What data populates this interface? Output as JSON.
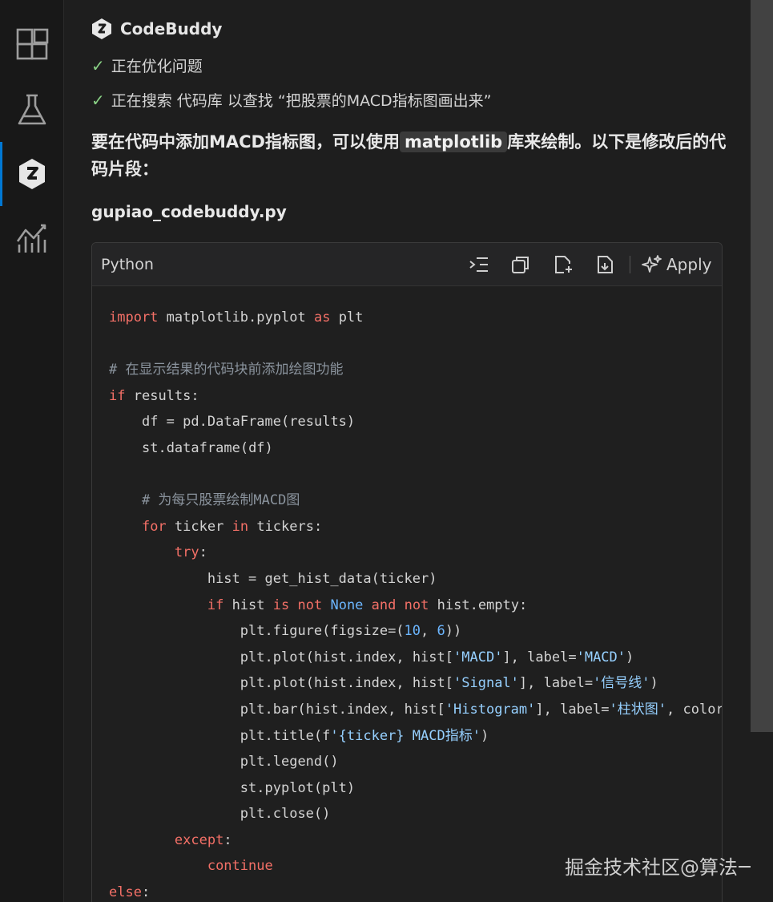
{
  "activity_bar": {
    "items": [
      {
        "icon": "extensions-icon"
      },
      {
        "icon": "flask-icon"
      },
      {
        "icon": "codebuddy-icon",
        "active": true
      },
      {
        "icon": "chart-icon"
      }
    ]
  },
  "agent": {
    "name": "CodeBuddy"
  },
  "steps": [
    "正在优化问题",
    "正在搜索 代码库 以查找 “把股票的MACD指标图画出来”"
  ],
  "answer": {
    "before": "要在代码中添加MACD指标图，可以使用",
    "code": "matplotlib",
    "after": "库来绘制。以下是修改后的代码片段："
  },
  "file": {
    "name": "gupiao_codebuddy.py"
  },
  "code_block": {
    "language": "Python",
    "apply_label": "Apply"
  },
  "code_lines": [
    "import matplotlib.pyplot as plt",
    "",
    "# 在显示结果的代码块前添加绘图功能",
    "if results:",
    "    df = pd.DataFrame(results)",
    "    st.dataframe(df)",
    "",
    "    # 为每只股票绘制MACD图",
    "    for ticker in tickers:",
    "        try:",
    "            hist = get_hist_data(ticker)",
    "            if hist is not None and not hist.empty:",
    "                plt.figure(figsize=(10, 6))",
    "                plt.plot(hist.index, hist['MACD'], label='MACD')",
    "                plt.plot(hist.index, hist['Signal'], label='信号线')",
    "                plt.bar(hist.index, hist['Histogram'], label='柱状图', color=",
    "                plt.title(f'{ticker} MACD指标')",
    "                plt.legend()",
    "                st.pyplot(plt)",
    "                plt.close()",
    "        except:",
    "            continue",
    "else:"
  ],
  "watermark": "掘金技术社区@算法一只狗",
  "colors": {
    "keyword": "#f47067",
    "comment": "#8b949e",
    "string": "#96d0ff",
    "number": "#6cb6ff",
    "active_accent": "#0078d4",
    "check": "#89d185"
  }
}
